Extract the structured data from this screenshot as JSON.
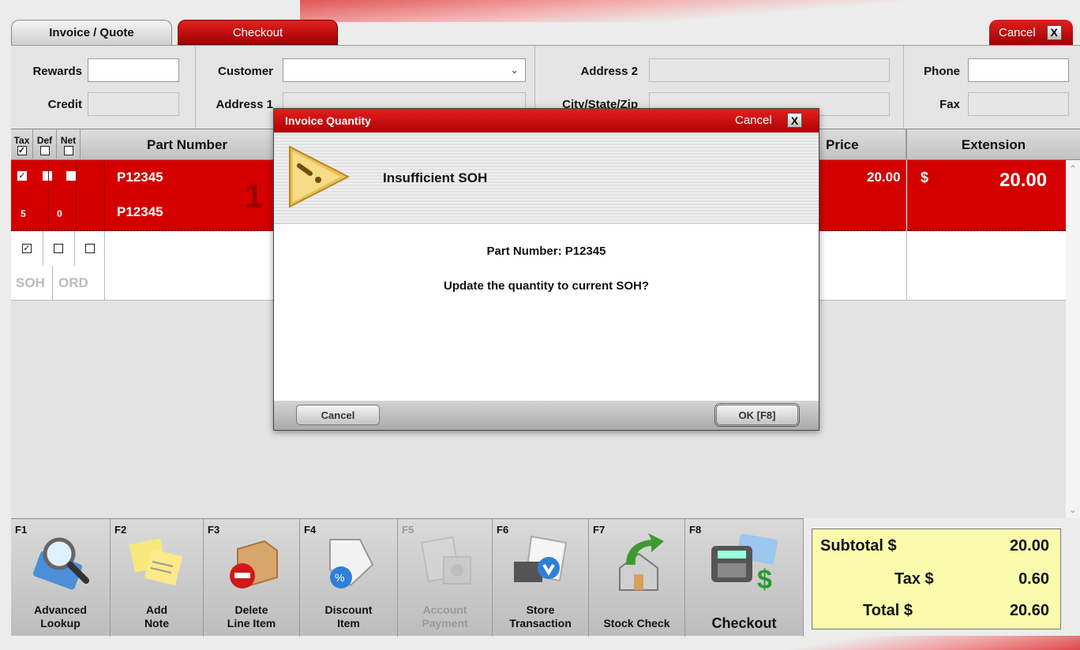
{
  "tabs": {
    "invoice": "Invoice / Quote",
    "checkout": "Checkout"
  },
  "window": {
    "cancel": "Cancel",
    "close_glyph": "X"
  },
  "form": {
    "rewards": "Rewards",
    "credit": "Credit",
    "customer": "Customer",
    "address1": "Address 1",
    "address2": "Address 2",
    "city_state_zip": "City/State/Zip",
    "phone": "Phone",
    "fax": "Fax",
    "customer_value": "",
    "rewards_value": ""
  },
  "grid": {
    "headers": {
      "tax": "Tax",
      "def": "Def",
      "net": "Net",
      "part_number": "Part Number",
      "price": "Price",
      "extension": "Extension"
    },
    "flags": {
      "tax_checked": true,
      "def_checked": false,
      "net_checked": false
    },
    "selected_row": {
      "part_number": "P12345",
      "part_number_2": "P12345",
      "qty": "1",
      "soh": "5",
      "ord": "0",
      "price": "20.00",
      "currency": "$",
      "extension": "20.00"
    },
    "row2": {
      "soh": "SOH",
      "ord": "ORD"
    }
  },
  "function_keys": [
    {
      "key": "F1",
      "label1": "Advanced",
      "label2": "Lookup",
      "enabled": true,
      "icon": "magnifier-book-icon"
    },
    {
      "key": "F2",
      "label1": "Add",
      "label2": "Note",
      "enabled": true,
      "icon": "sticky-notes-icon"
    },
    {
      "key": "F3",
      "label1": "Delete",
      "label2": "Line Item",
      "enabled": true,
      "icon": "delete-box-icon"
    },
    {
      "key": "F4",
      "label1": "Discount",
      "label2": "Item",
      "enabled": true,
      "icon": "discount-tag-icon"
    },
    {
      "key": "F5",
      "label1": "Account",
      "label2": "Payment",
      "enabled": false,
      "icon": "clipboard-safe-icon"
    },
    {
      "key": "F6",
      "label1": "Store",
      "label2": "Transaction",
      "enabled": true,
      "icon": "register-receipt-icon"
    },
    {
      "key": "F7",
      "label1": "",
      "label2": "Stock Check",
      "enabled": true,
      "icon": "house-arrow-icon"
    },
    {
      "key": "F8",
      "label1": "",
      "label2": "Checkout",
      "enabled": true,
      "icon": "card-terminal-icon"
    }
  ],
  "totals": {
    "subtotal_label": "Subtotal $",
    "subtotal": "20.00",
    "tax_label": "Tax $",
    "tax": "0.60",
    "total_label": "Total $",
    "total": "20.60"
  },
  "dialog": {
    "title": "Invoice Quantity",
    "cancel": "Cancel",
    "close_glyph": "X",
    "heading": "Insufficient SOH",
    "line1": "Part Number: P12345",
    "line2": "Update the quantity to current SOH?",
    "btn_cancel": "Cancel",
    "btn_ok": "OK [F8]"
  },
  "colors": {
    "accent_red": "#d40000",
    "totals_bg": "#fbfbad"
  }
}
